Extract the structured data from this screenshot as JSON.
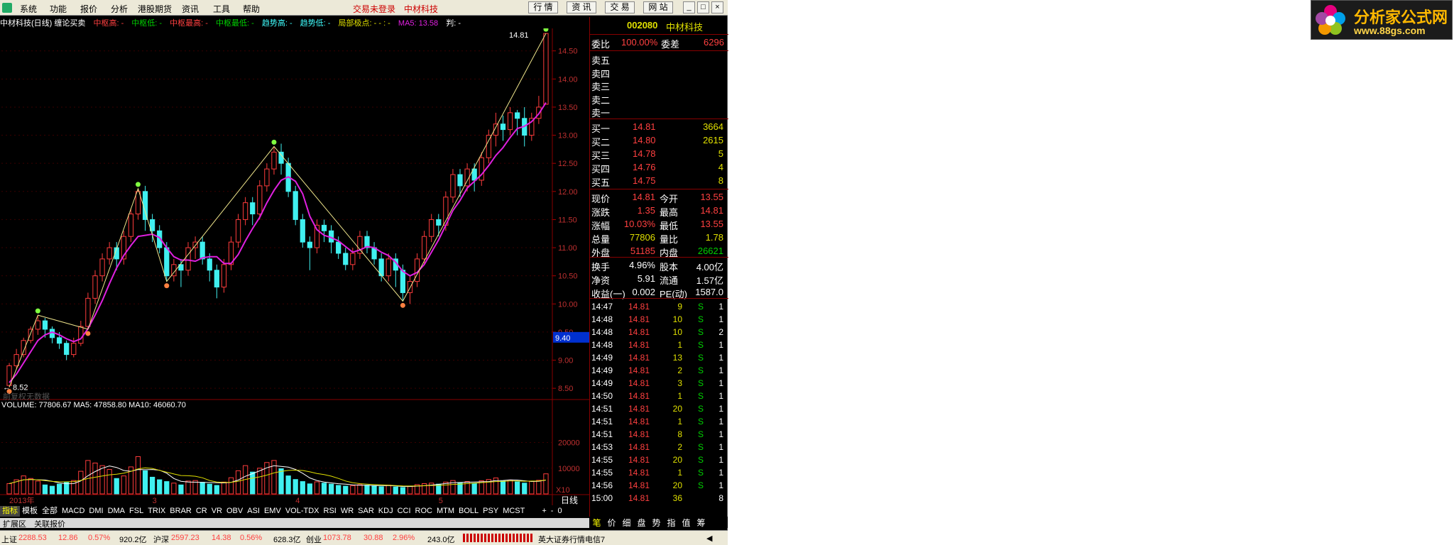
{
  "menu": [
    "系统",
    "功能",
    "报价",
    "分析",
    "港股期货",
    "资讯",
    "工具",
    "帮助"
  ],
  "account": {
    "status": "交易未登录",
    "stock": "中材科技"
  },
  "top_buttons": [
    "行 情",
    "资 讯",
    "交 易",
    "网 站"
  ],
  "chart_header": {
    "title": "中材科技(日线) 缠论买卖",
    "items": [
      "中枢高: -",
      "中枢低: -",
      "中枢最高: -",
      "中枢最低: -",
      "趋势高: -",
      "趋势低: -",
      "局部极点: - - : -",
      "MA5: 13.58",
      "判: -"
    ]
  },
  "price_axis": [
    "14.50",
    "14.00",
    "13.50",
    "13.00",
    "12.50",
    "12.00",
    "11.50",
    "11.00",
    "10.50",
    "10.00",
    "9.50",
    "9.00",
    "8.50"
  ],
  "cursor_price": "9.40",
  "high_label": "14.81",
  "low_label": "8.52",
  "no_data_label": "前复权无数据",
  "month_labels": [
    "2013年",
    "3",
    "4",
    "5"
  ],
  "vol_header": "VOLUME: 77806.67  MA5: 47858.80  MA10: 46060.70",
  "vol_axis": [
    "20000",
    "10000",
    "X10"
  ],
  "period": "日线",
  "indicators": [
    "指标",
    "模板",
    "全部",
    "MACD",
    "DMI",
    "DMA",
    "FSL",
    "TRIX",
    "BRAR",
    "CR",
    "VR",
    "OBV",
    "ASI",
    "EMV",
    "VOL-TDX",
    "RSI",
    "WR",
    "SAR",
    "KDJ",
    "CCI",
    "ROC",
    "MTM",
    "BOLL",
    "PSY",
    "MCST"
  ],
  "sub_tabs": [
    "扩展区",
    "关联报价"
  ],
  "quote": {
    "code": "002080",
    "name": "中材科技",
    "wb": {
      "label": "委比",
      "value": "100.00%",
      "label2": "委差",
      "value2": "6296"
    },
    "sells": [
      "卖五",
      "卖四",
      "卖三",
      "卖二",
      "卖一"
    ],
    "buys": [
      {
        "l": "买一",
        "p": "14.81",
        "v": "3664"
      },
      {
        "l": "买二",
        "p": "14.80",
        "v": "2615"
      },
      {
        "l": "买三",
        "p": "14.78",
        "v": "5"
      },
      {
        "l": "买四",
        "p": "14.76",
        "v": "4"
      },
      {
        "l": "买五",
        "p": "14.75",
        "v": "8"
      }
    ],
    "stats": [
      {
        "l": "现价",
        "v": "14.81",
        "l2": "今开",
        "v2": "13.55"
      },
      {
        "l": "涨跌",
        "v": "1.35",
        "l2": "最高",
        "v2": "14.81"
      },
      {
        "l": "涨幅",
        "v": "10.03%",
        "l2": "最低",
        "v2": "13.55"
      },
      {
        "l": "总量",
        "v": "77806",
        "l2": "量比",
        "v2": "1.78"
      },
      {
        "l": "外盘",
        "v": "51185",
        "l2": "内盘",
        "v2": "26621"
      }
    ],
    "stats2": [
      {
        "l": "换手",
        "v": "4.96%",
        "l2": "股本",
        "v2": "4.00亿"
      },
      {
        "l": "净资",
        "v": "5.91",
        "l2": "流通",
        "v2": "1.57亿"
      },
      {
        "l": "收益(一)",
        "v": "0.002",
        "l2": "PE(动)",
        "v2": "1587.0"
      }
    ],
    "ticks": [
      [
        "14:47",
        "14.81",
        "9",
        "S",
        "1"
      ],
      [
        "14:48",
        "14.81",
        "10",
        "S",
        "1"
      ],
      [
        "14:48",
        "14.81",
        "10",
        "S",
        "2"
      ],
      [
        "14:48",
        "14.81",
        "1",
        "S",
        "1"
      ],
      [
        "14:49",
        "14.81",
        "13",
        "S",
        "1"
      ],
      [
        "14:49",
        "14.81",
        "2",
        "S",
        "1"
      ],
      [
        "14:49",
        "14.81",
        "3",
        "S",
        "1"
      ],
      [
        "14:50",
        "14.81",
        "1",
        "S",
        "1"
      ],
      [
        "14:51",
        "14.81",
        "20",
        "S",
        "1"
      ],
      [
        "14:51",
        "14.81",
        "1",
        "S",
        "1"
      ],
      [
        "14:51",
        "14.81",
        "8",
        "S",
        "1"
      ],
      [
        "14:53",
        "14.81",
        "2",
        "S",
        "1"
      ],
      [
        "14:55",
        "14.81",
        "20",
        "S",
        "1"
      ],
      [
        "14:55",
        "14.81",
        "1",
        "S",
        "1"
      ],
      [
        "14:56",
        "14.81",
        "20",
        "S",
        "1"
      ],
      [
        "15:00",
        "14.81",
        "36",
        "",
        "8"
      ]
    ],
    "tabs": [
      "笔",
      "价",
      "细",
      "盘",
      "势",
      "指",
      "值",
      "筹"
    ]
  },
  "status": {
    "sh_label": "上证",
    "sh": "2288.53",
    "sh_chg": "12.86",
    "sh_pct": "0.57%",
    "sh_amt": "920.2亿",
    "hs_label": "沪深",
    "hs": "2597.23",
    "hs_chg": "14.38",
    "hs_pct": "0.56%",
    "hs_amt": "628.3亿",
    "cy_label": "创业",
    "cy": "1073.78",
    "cy_chg": "30.88",
    "cy_pct": "2.96%",
    "cy_amt": "243.0亿",
    "news": "英大证券行情电信7"
  },
  "brand": {
    "name": "分析家公式网",
    "url": "www.88gs.com"
  },
  "chart_data": {
    "type": "candlestick",
    "period": "日线",
    "ylim": [
      8.3,
      14.9
    ],
    "candles": [
      [
        8.55,
        8.9,
        8.52,
        8.95
      ],
      [
        8.9,
        9.1,
        8.85,
        9.2
      ],
      [
        9.1,
        9.35,
        9.05,
        9.4
      ],
      [
        9.35,
        9.55,
        9.3,
        9.6
      ],
      [
        9.55,
        9.7,
        9.45,
        9.8
      ],
      [
        9.7,
        9.55,
        9.4,
        9.75
      ],
      [
        9.55,
        9.4,
        9.3,
        9.6
      ],
      [
        9.4,
        9.3,
        9.2,
        9.5
      ],
      [
        9.3,
        9.1,
        9.0,
        9.35
      ],
      [
        9.1,
        9.3,
        9.05,
        9.4
      ],
      [
        9.3,
        9.6,
        9.25,
        9.7
      ],
      [
        9.6,
        10.1,
        9.55,
        10.2
      ],
      [
        10.1,
        10.5,
        10.0,
        10.6
      ],
      [
        10.5,
        10.8,
        10.4,
        10.9
      ],
      [
        10.8,
        11.0,
        10.7,
        11.1
      ],
      [
        11.0,
        10.8,
        10.6,
        11.1
      ],
      [
        10.8,
        11.2,
        10.7,
        11.3
      ],
      [
        11.2,
        11.6,
        11.1,
        11.7
      ],
      [
        11.6,
        12.0,
        11.5,
        12.05
      ],
      [
        12.0,
        11.5,
        11.3,
        12.1
      ],
      [
        11.5,
        11.3,
        11.1,
        11.6
      ],
      [
        11.3,
        11.0,
        10.9,
        11.4
      ],
      [
        11.0,
        10.5,
        10.4,
        11.1
      ],
      [
        10.5,
        10.7,
        10.4,
        10.8
      ],
      [
        10.7,
        10.6,
        10.3,
        10.8
      ],
      [
        10.6,
        11.0,
        10.5,
        11.1
      ],
      [
        11.0,
        11.1,
        10.8,
        11.2
      ],
      [
        11.1,
        10.8,
        10.7,
        11.2
      ],
      [
        10.8,
        10.6,
        10.4,
        10.9
      ],
      [
        10.6,
        10.3,
        10.1,
        10.7
      ],
      [
        10.3,
        10.7,
        10.2,
        10.8
      ],
      [
        10.7,
        11.1,
        10.6,
        11.2
      ],
      [
        11.1,
        11.5,
        11.0,
        11.6
      ],
      [
        11.5,
        11.8,
        11.4,
        11.9
      ],
      [
        11.8,
        11.6,
        11.4,
        11.9
      ],
      [
        11.6,
        12.1,
        11.5,
        12.2
      ],
      [
        12.1,
        12.4,
        12.0,
        12.5
      ],
      [
        12.4,
        12.7,
        12.3,
        12.8
      ],
      [
        12.7,
        12.5,
        12.3,
        12.85
      ],
      [
        12.5,
        12.0,
        11.9,
        12.6
      ],
      [
        12.0,
        11.5,
        11.4,
        12.1
      ],
      [
        11.5,
        11.1,
        11.0,
        11.6
      ],
      [
        11.1,
        11.0,
        10.6,
        11.2
      ],
      [
        11.0,
        11.4,
        10.9,
        11.5
      ],
      [
        11.4,
        11.3,
        11.1,
        11.5
      ],
      [
        11.3,
        11.1,
        10.9,
        11.4
      ],
      [
        11.1,
        10.9,
        10.8,
        11.2
      ],
      [
        10.9,
        10.7,
        10.6,
        11.0
      ],
      [
        10.7,
        10.9,
        10.6,
        11.0
      ],
      [
        10.9,
        11.2,
        10.8,
        11.3
      ],
      [
        11.2,
        11.0,
        10.9,
        11.3
      ],
      [
        11.0,
        10.8,
        10.7,
        11.1
      ],
      [
        10.8,
        10.5,
        10.4,
        10.9
      ],
      [
        10.5,
        10.8,
        10.4,
        10.9
      ],
      [
        10.8,
        10.6,
        10.3,
        10.9
      ],
      [
        10.6,
        10.2,
        10.05,
        10.7
      ],
      [
        10.2,
        10.4,
        10.0,
        10.5
      ],
      [
        10.4,
        10.8,
        10.3,
        10.9
      ],
      [
        10.8,
        11.2,
        10.7,
        11.3
      ],
      [
        11.2,
        11.5,
        11.1,
        11.6
      ],
      [
        11.5,
        11.4,
        11.2,
        11.6
      ],
      [
        11.4,
        11.9,
        11.3,
        12.0
      ],
      [
        11.9,
        12.3,
        11.8,
        12.4
      ],
      [
        12.3,
        12.1,
        11.9,
        12.4
      ],
      [
        12.1,
        12.4,
        12.0,
        12.5
      ],
      [
        12.4,
        12.2,
        12.0,
        12.5
      ],
      [
        12.2,
        12.6,
        12.1,
        12.7
      ],
      [
        12.6,
        13.0,
        12.5,
        13.1
      ],
      [
        13.0,
        13.2,
        12.8,
        13.4
      ],
      [
        13.2,
        13.1,
        12.9,
        13.35
      ],
      [
        13.1,
        13.4,
        13.0,
        13.5
      ],
      [
        13.4,
        13.3,
        13.0,
        13.45
      ],
      [
        13.3,
        13.0,
        12.8,
        13.5
      ],
      [
        13.0,
        13.3,
        12.9,
        13.4
      ],
      [
        13.3,
        13.5,
        13.2,
        13.7
      ],
      [
        13.55,
        14.81,
        13.55,
        14.81
      ]
    ],
    "volume": [
      4000,
      5500,
      7000,
      6000,
      5000,
      3500,
      3000,
      3800,
      4500,
      5200,
      8800,
      13000,
      12000,
      11000,
      9500,
      6000,
      7000,
      10500,
      14500,
      9000,
      6500,
      5500,
      4800,
      4200,
      3500,
      5000,
      5200,
      4500,
      3800,
      3300,
      4600,
      6300,
      9000,
      11000,
      8500,
      10000,
      12200,
      13000,
      9800,
      7000,
      5600,
      4800,
      3900,
      4700,
      4200,
      3800,
      3300,
      3000,
      3200,
      3600,
      3400,
      3100,
      2800,
      3400,
      2700,
      2500,
      3000,
      3600,
      4000,
      4200,
      3800,
      4600,
      5200,
      4400,
      4800,
      4100,
      5100,
      5600,
      6200,
      5000,
      5400,
      4700,
      4200,
      4900,
      5300,
      7806.67
    ],
    "ma5": [
      8.6,
      8.75,
      8.95,
      9.15,
      9.35,
      9.45,
      9.5,
      9.45,
      9.38,
      9.33,
      9.38,
      9.56,
      9.8,
      10.06,
      10.36,
      10.64,
      10.86,
      11.04,
      11.2,
      11.22,
      11.24,
      11.18,
      11.0,
      10.84,
      10.78,
      10.78,
      10.76,
      10.82,
      10.84,
      10.84,
      10.72,
      10.72,
      10.88,
      11.12,
      11.34,
      11.54,
      11.8,
      12.02,
      12.2,
      12.26,
      12.18,
      11.96,
      11.56,
      11.32,
      11.22,
      11.18,
      11.12,
      11.02,
      10.92,
      10.96,
      11.02,
      11.0,
      10.92,
      10.86,
      10.74,
      10.58,
      10.5,
      10.56,
      10.7,
      10.92,
      11.14,
      11.4,
      11.66,
      11.84,
      12.06,
      12.18,
      12.3,
      12.46,
      12.64,
      12.78,
      12.96,
      13.12,
      13.16,
      13.24,
      13.38,
      13.58
    ]
  }
}
